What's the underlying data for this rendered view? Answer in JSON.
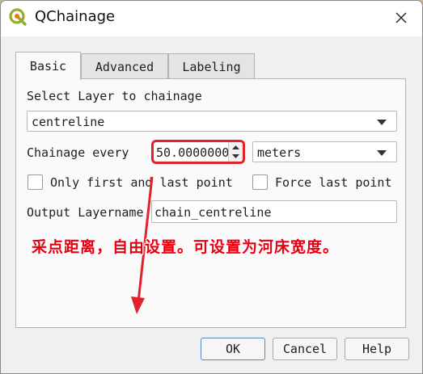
{
  "window": {
    "title": "QChainage",
    "icon": "qgis-logo-icon",
    "close_icon": "close-icon"
  },
  "tabs": [
    {
      "label": "Basic",
      "active": true
    },
    {
      "label": "Advanced",
      "active": false
    },
    {
      "label": "Labeling",
      "active": false
    }
  ],
  "basic": {
    "select_layer_label": "Select Layer to chainage",
    "layer_value": "centreline",
    "chainage_label": "Chainage every",
    "chainage_value": "50.0000000",
    "unit_value": "meters",
    "only_first_last_label": "Only first and last point",
    "only_first_last_checked": false,
    "force_last_label": "Force last point",
    "force_last_checked": false,
    "output_label": "Output Layername",
    "output_value": "chain_centreline"
  },
  "buttons": {
    "ok": "OK",
    "cancel": "Cancel",
    "help": "Help"
  },
  "annotation": {
    "text": "采点距离，自由设置。可设置为河床宽度。",
    "color": "#e60012"
  }
}
